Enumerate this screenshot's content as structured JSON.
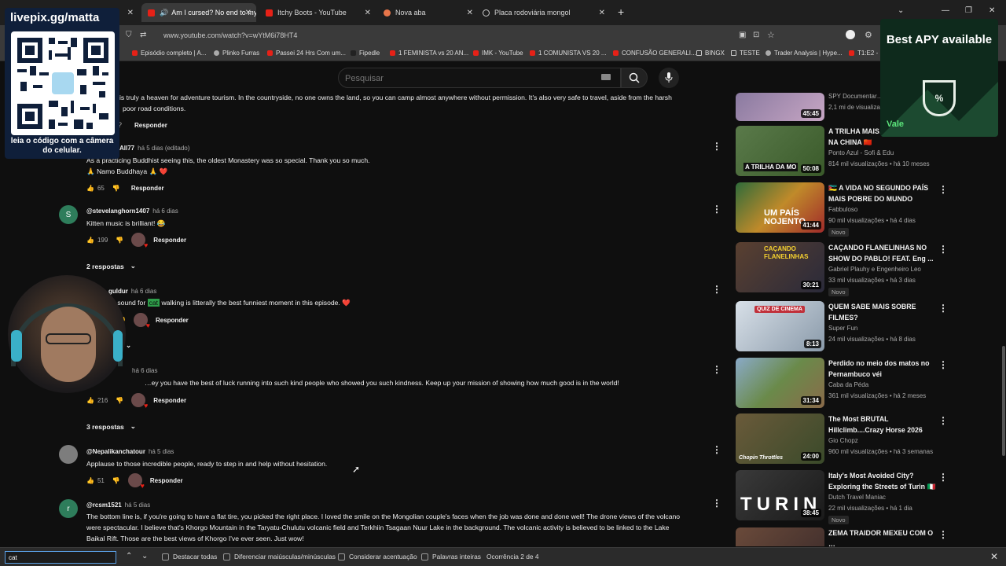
{
  "tabs": [
    {
      "label": "Am I cursed? No end to my",
      "active": true
    },
    {
      "label": "Itchy Boots - YouTube",
      "active": false
    },
    {
      "label": "Nova aba",
      "active": false
    },
    {
      "label": "Placa rodoviária mongol",
      "active": false
    }
  ],
  "address": {
    "url": "www.youtube.com/watch?v=wYtM6i78HT4"
  },
  "bookmarks": [
    "Episódio completo | A...",
    "Plinko Furras",
    "Passei 24 Hrs Com um...",
    "Fipedle",
    "1 FEMINISTA vs 20 AN...",
    "IMK - YouTube",
    "1 COMUNISTA VS 20 ...",
    "CONFUSÃO GENERALI...",
    "BINGX",
    "TESTE",
    "Trader Analysis | Hype...",
    "T1:E2 -"
  ],
  "search": {
    "placeholder": "Pesquisar"
  },
  "comments": [
    {
      "author": "",
      "time": "",
      "text_line1": "is truly a heaven for adventure tourism. In the countryside, no one owns the land, so you can camp almost anywhere without permission. It's also very safe to travel, aside from the harsh",
      "text_line2": "poor road conditions.",
      "likes": "",
      "reply": "Responder"
    },
    {
      "author": "All77",
      "time": "há 5 dias (editado)",
      "text_line1": "As a practicing Buddhist seeing this, the oldest Monastery was so special. Thank you so much.",
      "text_line2": "🙏 Namo Buddhaya 🙏 ❤️",
      "likes": "65",
      "reply": "Responder"
    },
    {
      "author": "@stevelanghorn1407",
      "time": "há 6 dias",
      "avatar_letter": "S",
      "text_line1": "Kitten music is brilliant! 😂",
      "likes": "199",
      "reply": "Responder",
      "replies": "2 respostas"
    },
    {
      "author": "…guldur",
      "time": "há 6 dias",
      "text_before": "…t sound for ",
      "highlight": "cat",
      "text_after": " walking is litterally the best funniest moment in this episode. ❤️",
      "reply": "Responder"
    },
    {
      "author": "",
      "time": "há 6 dias",
      "text_line1": "…ey you have the best of luck running into such kind people who showed you such kindness. Keep up your mission of showing how much good is in the world!",
      "likes": "216",
      "reply": "Responder",
      "replies": "3 respostas"
    },
    {
      "author": "@Nepalikanchatour",
      "time": "há 5 dias",
      "text_line1": "Applause to those incredible people, ready to step in and help without hesitation.",
      "likes": "51",
      "reply": "Responder"
    },
    {
      "author": "@rcsm1521",
      "time": "há 5 dias",
      "avatar_letter": "r",
      "text_line1": "The bottom line is, if you're going to have a flat tire, you picked the right place. I loved the smile on the Mongolian couple's faces when the job was done and done well! The drone views of the volcano",
      "text_line2": "were spectacular. I believe that's Khorgo Mountain in the Taryatu-Chulutu volcanic field and Terkhiin Tsagaan Nuur Lake in the background. The volcanic activity is believed to be linked to the Lake",
      "text_line3": "Baikal Rift. Those are the best views of Khorgo I've ever seen. Just wow!"
    }
  ],
  "recommendations": [
    {
      "title": "",
      "channel": "SPY Documentar…",
      "meta": "2,1 mi de visualiza…",
      "duration": "45:45",
      "color": "#7a8aa6"
    },
    {
      "title": "A TRILHA MAIS… MUNDO FICA NA CHINA 🇨🇳",
      "channel": "Ponto Azul - Sofi & Edu",
      "meta": "814 mil visualizações • há 10 meses",
      "duration": "50:08",
      "thumb_text": "A TRILHA DA MO",
      "color": "#4a6b3a"
    },
    {
      "title": "🇲🇿 A VIDA NO SEGUNDO PAÍS MAIS POBRE DO MUNDO",
      "channel": "Fabbuloso",
      "meta": "90 mil visualizações • há 4 dias",
      "duration": "41:44",
      "thumb_text": "UM PAÍS NOJENTO",
      "new": "Novo",
      "color": "#6b3a2a"
    },
    {
      "title": "CAÇANDO FLANELINHAS NO SHOW DO PABLO! FEAT. Eng ...",
      "channel": "Gabriel Plauhy e Engenheiro Leo",
      "meta": "33 mil visualizações • há 3 dias",
      "duration": "30:21",
      "thumb_text": "CAÇANDO FLANELINHAS",
      "new": "Novo",
      "color": "#3a2f2a"
    },
    {
      "title": "QUEM SABE MAIS SOBRE FILMES?",
      "channel": "Super Fun",
      "meta": "24 mil visualizações • há 8 dias",
      "duration": "8:13",
      "thumb_text": "QUIZ DE CINEMA",
      "color": "#5a6a7a"
    },
    {
      "title": "Perdido no meio dos matos no Pernambuco véi",
      "channel": "Caba da Péda",
      "meta": "361 mil visualizações • há 2 meses",
      "duration": "31:34",
      "color": "#6a8a4a"
    },
    {
      "title": "The Most BRUTAL Hillclimb....Crazy Horse 2026",
      "channel": "Gio Chopz",
      "meta": "960 mil visualizações • há 3 semanas",
      "duration": "24:00",
      "thumb_text": "Chopin Throttles",
      "color": "#5a4a3a"
    },
    {
      "title": "Italy's Most Avoided City? Exploring the Streets of Turin 🇮🇹",
      "channel": "Dutch Travel Maniac",
      "meta": "22 mil visualizações • há 1 dia",
      "duration": "38:45",
      "thumb_text": "TURIN",
      "new": "Novo",
      "color": "#2a2a2a"
    },
    {
      "title": "ZEMA TRAIDOR MEXEU COM O …",
      "channel": "",
      "meta": "",
      "duration": "",
      "color": "#4a3a3a"
    }
  ],
  "overlays": {
    "qr_title": "livepix.gg/matta",
    "qr_caption": "leia o código com a câmera do celular.",
    "ad_title": "Best APY available",
    "ad_brand": "Vale"
  },
  "findbar": {
    "query": "cat",
    "options": [
      "Destacar todas",
      "Diferenciar maiúsculas/minúsculas",
      "Considerar acentuação",
      "Palavras inteiras"
    ],
    "status": "Ocorrência 2 de 4"
  },
  "colors": {
    "background": "#0f0f0f",
    "youtube_red": "#e62117",
    "highlight": "#2e9e4a"
  }
}
